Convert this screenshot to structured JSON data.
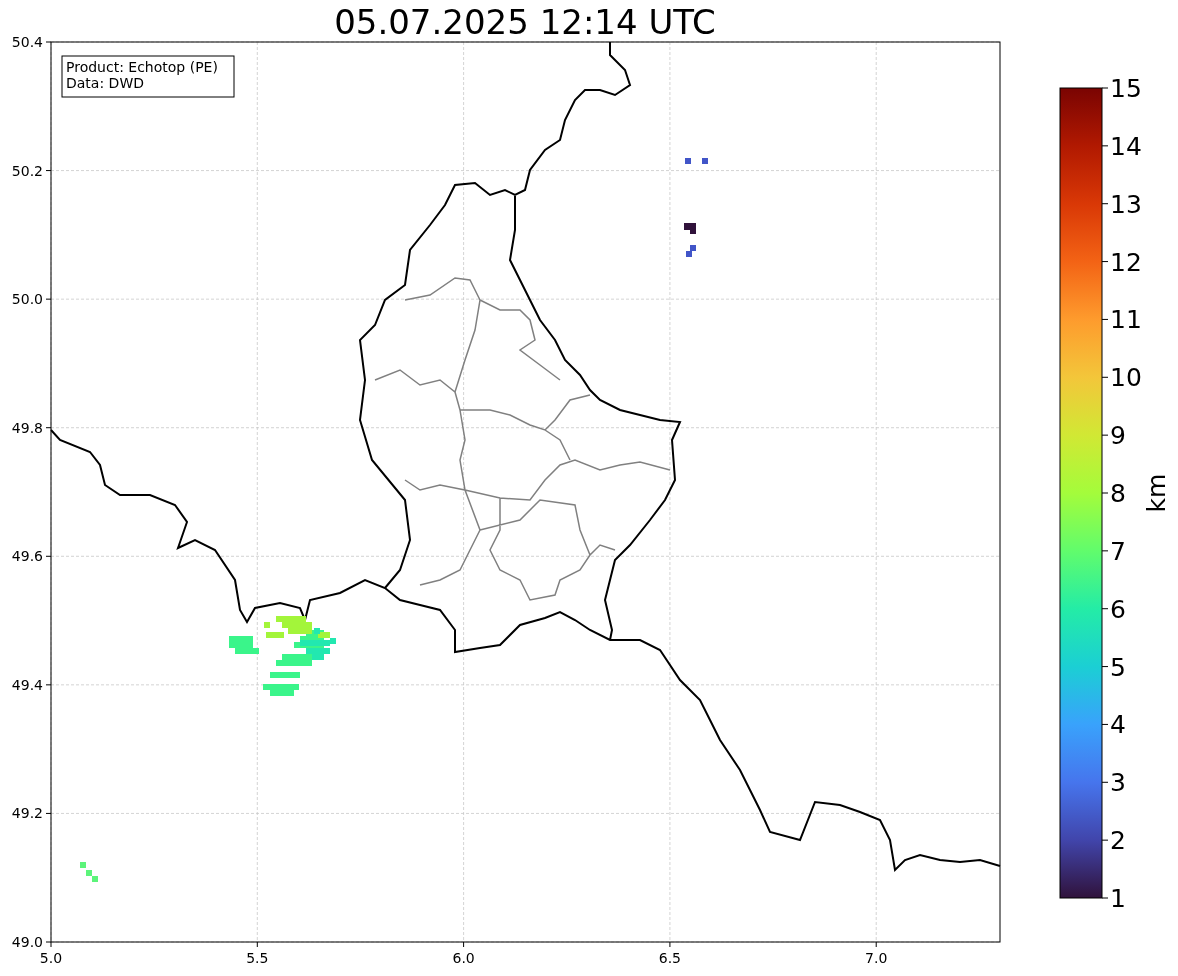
{
  "title": "05.07.2025 12:14 UTC",
  "info_box": [
    "Product: Echotop (PE)",
    "Data: DWD"
  ],
  "x_ticks": [
    "5.0",
    "5.5",
    "6.0",
    "6.5",
    "7.0"
  ],
  "y_ticks": [
    "50.4",
    "50.2",
    "50.0",
    "49.8",
    "49.6",
    "49.4",
    "49.2",
    "49.0"
  ],
  "colorbar": {
    "label": "km",
    "ticks": [
      "15",
      "14",
      "13",
      "12",
      "11",
      "10",
      "9",
      "8",
      "7",
      "6",
      "5",
      "4",
      "3",
      "2",
      "1"
    ]
  }
}
